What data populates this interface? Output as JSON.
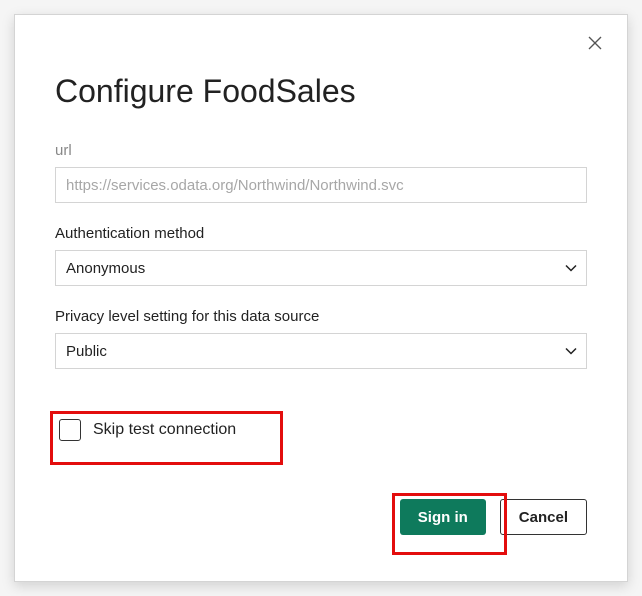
{
  "modal": {
    "title": "Configure FoodSales",
    "url_field": {
      "label": "url",
      "value": "https://services.odata.org/Northwind/Northwind.svc"
    },
    "auth_method": {
      "label": "Authentication method",
      "value": "Anonymous"
    },
    "privacy_level": {
      "label": "Privacy level setting for this data source",
      "value": "Public"
    },
    "skip_test": {
      "label": "Skip test connection"
    },
    "buttons": {
      "signin": "Sign in",
      "cancel": "Cancel"
    }
  }
}
